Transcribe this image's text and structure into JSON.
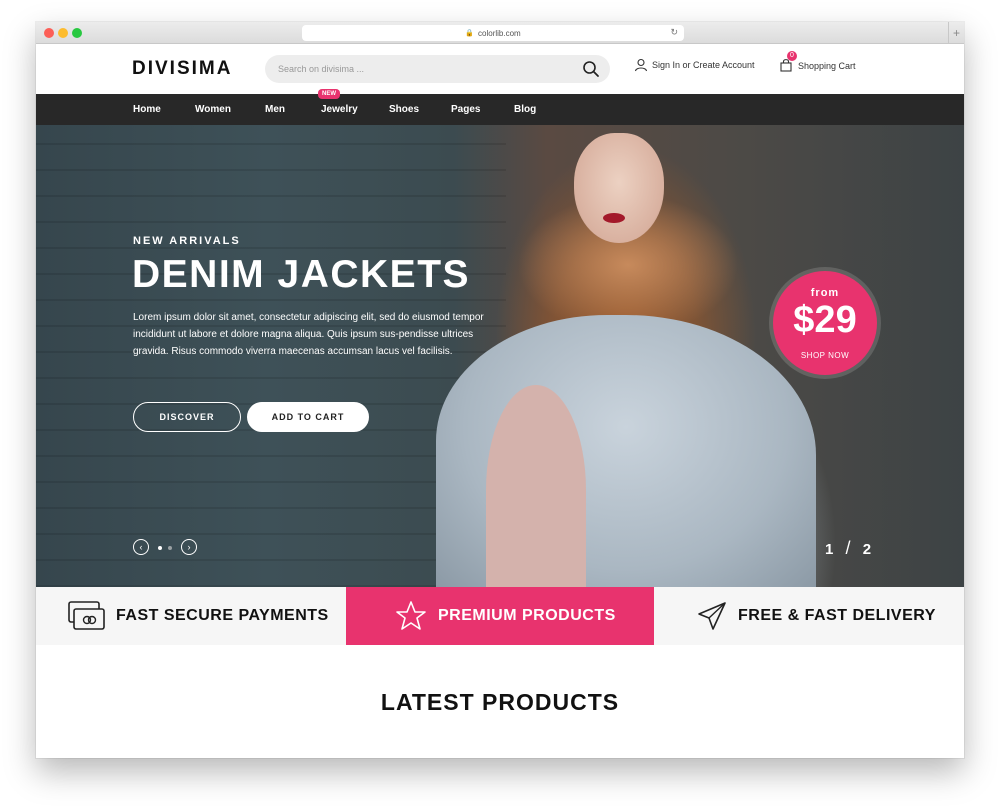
{
  "browser": {
    "url": "colorlib.com",
    "new_tab_label": "+"
  },
  "brand": {
    "logo_text": "DIVISIMA",
    "accent_color": "#e8336e"
  },
  "search": {
    "placeholder": "Search on divisima ..."
  },
  "header": {
    "account_label": "Sign In or Create Account",
    "cart_label": "Shopping Cart",
    "cart_count": "0"
  },
  "nav": {
    "items": [
      {
        "label": "Home"
      },
      {
        "label": "Women"
      },
      {
        "label": "Men"
      },
      {
        "label": "Jewelry",
        "badge": "NEW"
      },
      {
        "label": "Shoes"
      },
      {
        "label": "Pages"
      },
      {
        "label": "Blog"
      }
    ]
  },
  "hero": {
    "kicker": "NEW ARRIVALS",
    "title": "DENIM JACKETS",
    "text": "Lorem ipsum dolor sit amet, consectetur adipiscing elit, sed do eiusmod tempor incididunt ut labore et dolore magna aliqua. Quis ipsum sus-pendisse ultrices gravida. Risus commodo viverra maecenas accumsan lacus vel facilisis.",
    "discover_label": "DISCOVER",
    "add_to_cart_label": "ADD TO CART",
    "price_from": "from",
    "price": "$29",
    "price_cta": "SHOP NOW",
    "slide_current": "1",
    "slide_total": "2",
    "prev_icon": "chevron-left-icon",
    "next_icon": "chevron-right-icon"
  },
  "features": [
    {
      "label": "FAST SECURE PAYMENTS",
      "icon": "credit-card-icon"
    },
    {
      "label": "PREMIUM PRODUCTS",
      "icon": "star-icon"
    },
    {
      "label": "FREE & FAST DELIVERY",
      "icon": "paper-plane-icon"
    }
  ],
  "latest": {
    "title": "LATEST PRODUCTS"
  }
}
